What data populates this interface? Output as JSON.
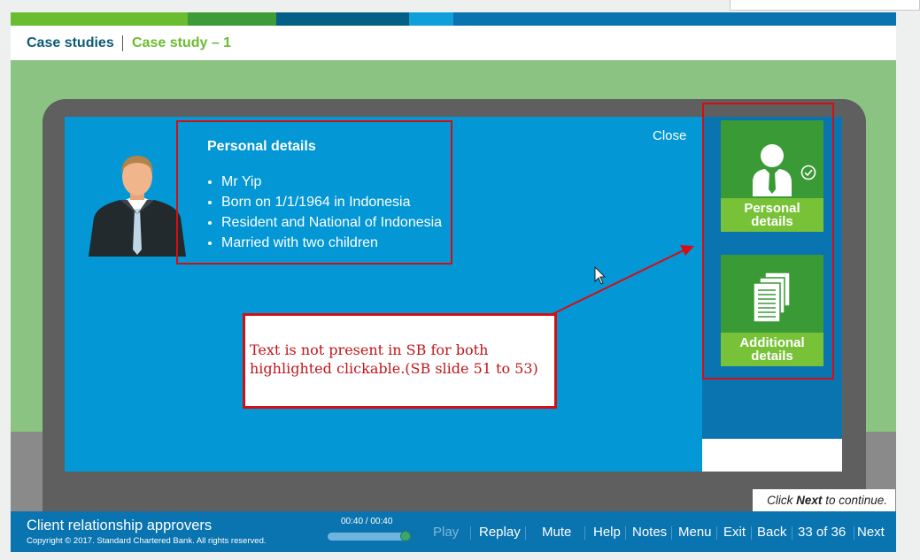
{
  "colors": {
    "brand_green": "#6abd2e",
    "brand_blue": "#0a74b0",
    "screen_blue": "#0397d5",
    "highlight_red": "#d40f14"
  },
  "breadcrumb": {
    "root": "Case studies",
    "current": "Case study – 1"
  },
  "screen": {
    "close_label": "Close",
    "personal_details": {
      "title": "Personal details",
      "items": [
        "Mr Yip",
        "Born on 1/1/1964 in Indonesia",
        "Resident and National of Indonesia",
        "Married with two children"
      ]
    },
    "tiles": [
      {
        "line1": "Personal",
        "line2": "details",
        "icon": "person-icon",
        "status_icon": "check-circle-icon"
      },
      {
        "line1": "Additional",
        "line2": "details",
        "icon": "documents-icon"
      }
    ]
  },
  "annotation": {
    "line1": "Text is not present in SB for both",
    "line2": "highlighted clickable.(SB slide 51 to 53)"
  },
  "hint": {
    "pre": "Click ",
    "bold": "Next",
    "post": " to continue."
  },
  "footer": {
    "course_title": "Client relationship approvers",
    "copyright": "Copyright © 2017. Standard Chartered Bank. All rights reserved.",
    "time": "00:40 / 00:40",
    "progress": 1.0,
    "nav": {
      "play": "Play",
      "replay": "Replay",
      "mute": "Mute",
      "help": "Help",
      "notes": "Notes",
      "menu": "Menu",
      "exit": "Exit",
      "back": "Back",
      "page": "33 of 36",
      "next": "Next"
    }
  }
}
